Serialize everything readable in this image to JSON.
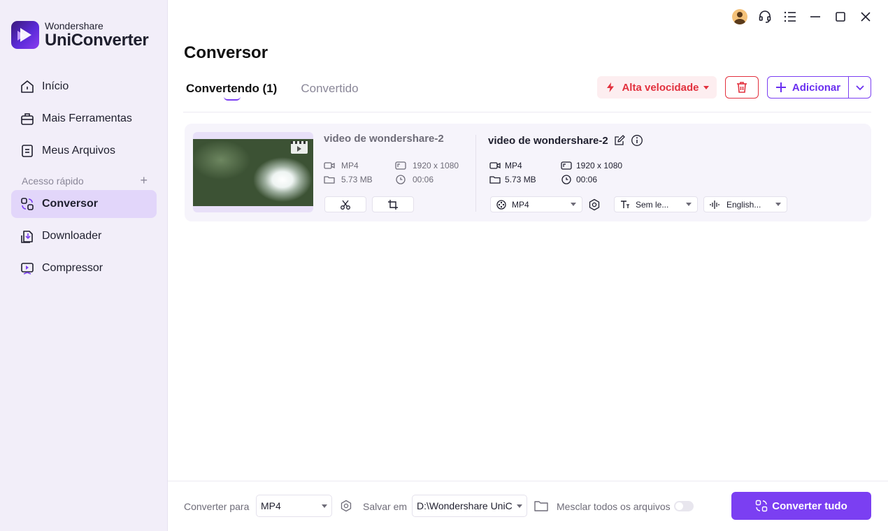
{
  "app": {
    "brand_small": "Wondershare",
    "brand_big": "UniConverter"
  },
  "sidebar": {
    "items": [
      {
        "label": "Início",
        "icon": "home-icon"
      },
      {
        "label": "Mais Ferramentas",
        "icon": "toolbox-icon"
      },
      {
        "label": "Meus Arquivos",
        "icon": "files-icon"
      }
    ],
    "quick_access_label": "Acesso rápido",
    "quick_items": [
      {
        "label": "Conversor",
        "icon": "converter-icon",
        "active": true
      },
      {
        "label": "Downloader",
        "icon": "downloader-icon"
      },
      {
        "label": "Compressor",
        "icon": "compressor-icon"
      }
    ]
  },
  "main": {
    "title": "Conversor",
    "tabs": [
      {
        "label": "Convertendo (1)",
        "active": true
      },
      {
        "label": "Convertido",
        "active": false
      }
    ],
    "speed_label": "Alta velocidade",
    "add_label": "Adicionar"
  },
  "file": {
    "source": {
      "name": "video de wondershare-2",
      "format": "MP4",
      "resolution": "1920 x 1080",
      "size": "5.73 MB",
      "duration": "00:06"
    },
    "target": {
      "name": "video de wondershare-2",
      "format": "MP4",
      "resolution": "1920 x 1080",
      "size": "5.73 MB",
      "duration": "00:06",
      "format_select": "MP4",
      "subtitle_select": "Sem le...",
      "audio_select": "English..."
    }
  },
  "bottom": {
    "convert_to_label": "Converter para",
    "convert_to_value": "MP4",
    "save_in_label": "Salvar em",
    "save_in_value": "D:\\Wondershare UniC",
    "merge_label": "Mesclar todos os arquivos",
    "merge_on": false,
    "convert_all_label": "Converter tudo"
  },
  "colors": {
    "accent": "#7b3ff2",
    "danger": "#e2313e",
    "sidebar_bg": "#f2eef9"
  }
}
